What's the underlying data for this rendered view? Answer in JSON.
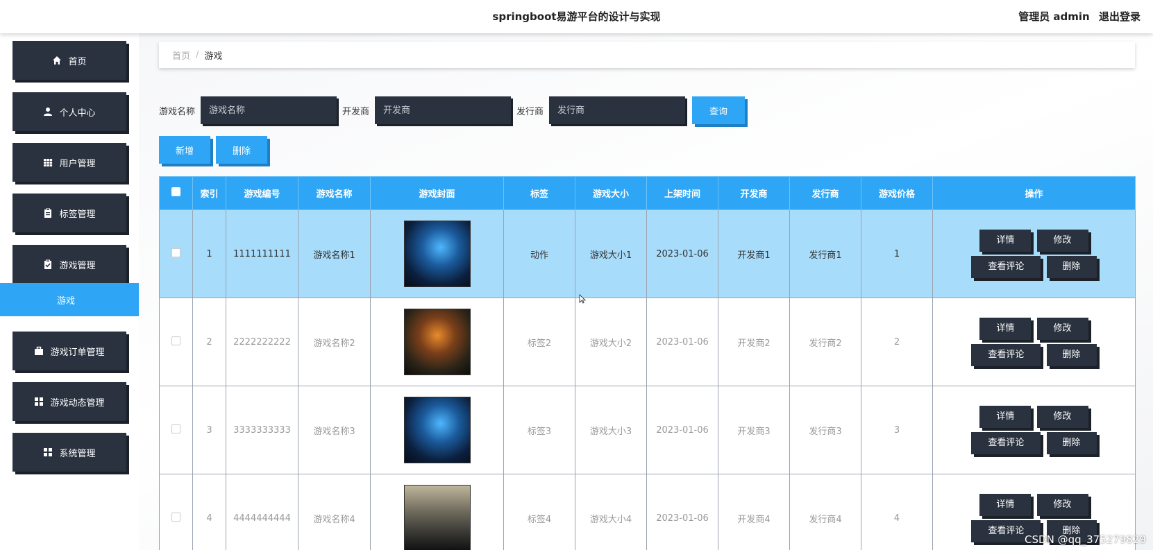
{
  "header": {
    "title": "springboot易游平台的设计与实现",
    "user_label": "管理员 admin",
    "logout_label": "退出登录"
  },
  "sidebar": {
    "items": [
      {
        "label": "首页",
        "icon": "home-icon"
      },
      {
        "label": "个人中心",
        "icon": "user-icon"
      },
      {
        "label": "用户管理",
        "icon": "grid-icon"
      },
      {
        "label": "标签管理",
        "icon": "clipboard-icon"
      },
      {
        "label": "游戏管理",
        "icon": "clipboard-check-icon"
      },
      {
        "label": "游戏订单管理",
        "icon": "briefcase-icon"
      },
      {
        "label": "游戏动态管理",
        "icon": "apps-icon"
      },
      {
        "label": "系统管理",
        "icon": "apps-icon"
      }
    ],
    "active_submenu": "游戏"
  },
  "breadcrumb": {
    "home": "首页",
    "separator": "/",
    "current": "游戏"
  },
  "search": {
    "name_label": "游戏名称",
    "name_placeholder": "游戏名称",
    "developer_label": "开发商",
    "developer_placeholder": "开发商",
    "publisher_label": "发行商",
    "publisher_placeholder": "发行商",
    "query_label": "查询"
  },
  "actions": {
    "add_label": "新增",
    "delete_label": "删除"
  },
  "table": {
    "headers": [
      "索引",
      "游戏编号",
      "游戏名称",
      "游戏封面",
      "标签",
      "游戏大小",
      "上架时间",
      "开发商",
      "发行商",
      "游戏价格",
      "操作"
    ],
    "rows": [
      {
        "index": "1",
        "code": "1111111111",
        "name": "游戏名称1",
        "tag": "动作",
        "size": "游戏大小1",
        "date": "2023-01-06",
        "developer": "开发商1",
        "publisher": "发行商1",
        "price": "1",
        "selected": true
      },
      {
        "index": "2",
        "code": "2222222222",
        "name": "游戏名称2",
        "tag": "标签2",
        "size": "游戏大小2",
        "date": "2023-01-06",
        "developer": "开发商2",
        "publisher": "发行商2",
        "price": "2",
        "selected": false
      },
      {
        "index": "3",
        "code": "3333333333",
        "name": "游戏名称3",
        "tag": "标签3",
        "size": "游戏大小3",
        "date": "2023-01-06",
        "developer": "开发商3",
        "publisher": "发行商3",
        "price": "3",
        "selected": false
      },
      {
        "index": "4",
        "code": "4444444444",
        "name": "游戏名称4",
        "tag": "标签4",
        "size": "游戏大小4",
        "date": "2023-01-06",
        "developer": "开发商4",
        "publisher": "发行商4",
        "price": "4",
        "selected": false
      }
    ],
    "op_labels": {
      "detail": "详情",
      "edit": "修改",
      "comments": "查看评论",
      "delete": "删除"
    }
  },
  "watermark": "CSDN @qq_375279829",
  "colors": {
    "accent": "#2ea6f5",
    "dark": "#2a323f",
    "selected_row": "#a8dcfb"
  }
}
